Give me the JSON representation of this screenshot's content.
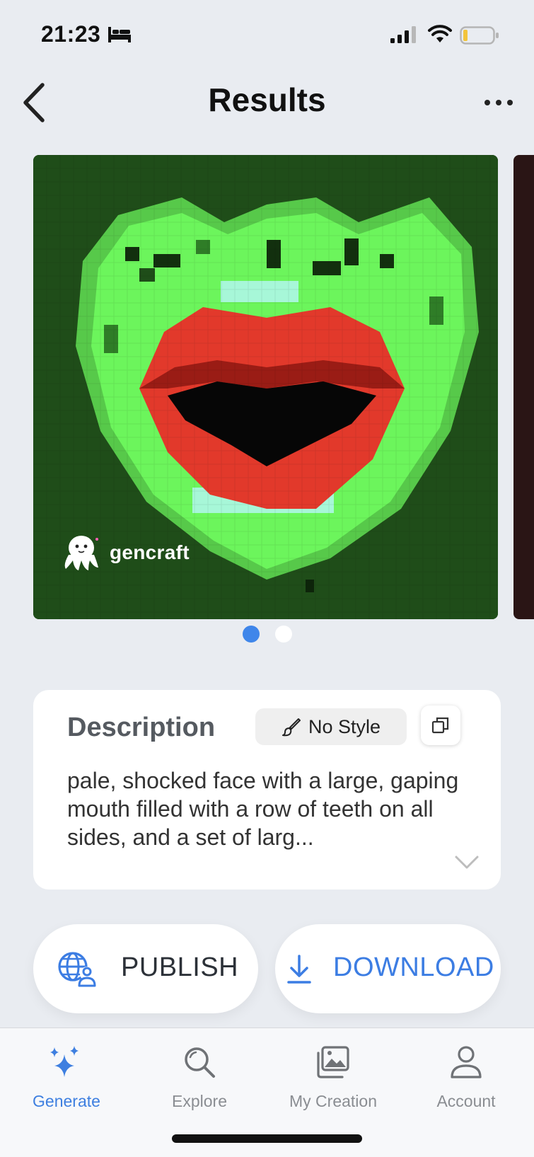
{
  "status_bar": {
    "time": "21:23",
    "icons": [
      "bed-icon",
      "signal-icon",
      "wifi-icon",
      "battery-icon"
    ]
  },
  "header": {
    "title": "Results",
    "back_icon": "chevron-left-icon",
    "more_icon": "ellipsis-icon"
  },
  "carousel": {
    "watermark": "gencraft",
    "page_count": 2,
    "active_page": 1
  },
  "description": {
    "title": "Description",
    "style_label": "No Style",
    "text": "pale, shocked face with a large, gaping mouth filled with a row of teeth on all sides, and a set of larg..."
  },
  "actions": {
    "publish_label": "PUBLISH",
    "download_label": "DOWNLOAD"
  },
  "tabs": [
    {
      "label": "Generate",
      "icon": "sparkles-icon",
      "active": true
    },
    {
      "label": "Explore",
      "icon": "search-icon",
      "active": false
    },
    {
      "label": "My Creation",
      "icon": "gallery-icon",
      "active": false
    },
    {
      "label": "Account",
      "icon": "user-icon",
      "active": false
    }
  ],
  "colors": {
    "accent": "#3f86ea",
    "background": "#e9ecf1"
  }
}
